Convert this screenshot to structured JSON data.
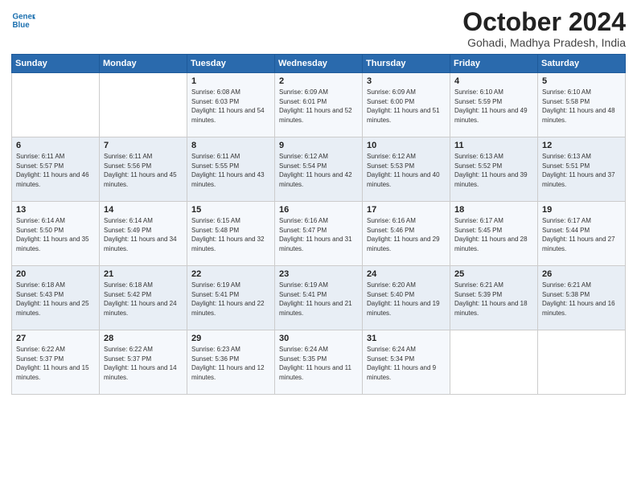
{
  "header": {
    "logo_line1": "General",
    "logo_line2": "Blue",
    "title": "October 2024",
    "subtitle": "Gohadi, Madhya Pradesh, India"
  },
  "weekdays": [
    "Sunday",
    "Monday",
    "Tuesday",
    "Wednesday",
    "Thursday",
    "Friday",
    "Saturday"
  ],
  "weeks": [
    [
      {
        "day": "",
        "info": ""
      },
      {
        "day": "",
        "info": ""
      },
      {
        "day": "1",
        "info": "Sunrise: 6:08 AM\nSunset: 6:03 PM\nDaylight: 11 hours and 54 minutes."
      },
      {
        "day": "2",
        "info": "Sunrise: 6:09 AM\nSunset: 6:01 PM\nDaylight: 11 hours and 52 minutes."
      },
      {
        "day": "3",
        "info": "Sunrise: 6:09 AM\nSunset: 6:00 PM\nDaylight: 11 hours and 51 minutes."
      },
      {
        "day": "4",
        "info": "Sunrise: 6:10 AM\nSunset: 5:59 PM\nDaylight: 11 hours and 49 minutes."
      },
      {
        "day": "5",
        "info": "Sunrise: 6:10 AM\nSunset: 5:58 PM\nDaylight: 11 hours and 48 minutes."
      }
    ],
    [
      {
        "day": "6",
        "info": "Sunrise: 6:11 AM\nSunset: 5:57 PM\nDaylight: 11 hours and 46 minutes."
      },
      {
        "day": "7",
        "info": "Sunrise: 6:11 AM\nSunset: 5:56 PM\nDaylight: 11 hours and 45 minutes."
      },
      {
        "day": "8",
        "info": "Sunrise: 6:11 AM\nSunset: 5:55 PM\nDaylight: 11 hours and 43 minutes."
      },
      {
        "day": "9",
        "info": "Sunrise: 6:12 AM\nSunset: 5:54 PM\nDaylight: 11 hours and 42 minutes."
      },
      {
        "day": "10",
        "info": "Sunrise: 6:12 AM\nSunset: 5:53 PM\nDaylight: 11 hours and 40 minutes."
      },
      {
        "day": "11",
        "info": "Sunrise: 6:13 AM\nSunset: 5:52 PM\nDaylight: 11 hours and 39 minutes."
      },
      {
        "day": "12",
        "info": "Sunrise: 6:13 AM\nSunset: 5:51 PM\nDaylight: 11 hours and 37 minutes."
      }
    ],
    [
      {
        "day": "13",
        "info": "Sunrise: 6:14 AM\nSunset: 5:50 PM\nDaylight: 11 hours and 35 minutes."
      },
      {
        "day": "14",
        "info": "Sunrise: 6:14 AM\nSunset: 5:49 PM\nDaylight: 11 hours and 34 minutes."
      },
      {
        "day": "15",
        "info": "Sunrise: 6:15 AM\nSunset: 5:48 PM\nDaylight: 11 hours and 32 minutes."
      },
      {
        "day": "16",
        "info": "Sunrise: 6:16 AM\nSunset: 5:47 PM\nDaylight: 11 hours and 31 minutes."
      },
      {
        "day": "17",
        "info": "Sunrise: 6:16 AM\nSunset: 5:46 PM\nDaylight: 11 hours and 29 minutes."
      },
      {
        "day": "18",
        "info": "Sunrise: 6:17 AM\nSunset: 5:45 PM\nDaylight: 11 hours and 28 minutes."
      },
      {
        "day": "19",
        "info": "Sunrise: 6:17 AM\nSunset: 5:44 PM\nDaylight: 11 hours and 27 minutes."
      }
    ],
    [
      {
        "day": "20",
        "info": "Sunrise: 6:18 AM\nSunset: 5:43 PM\nDaylight: 11 hours and 25 minutes."
      },
      {
        "day": "21",
        "info": "Sunrise: 6:18 AM\nSunset: 5:42 PM\nDaylight: 11 hours and 24 minutes."
      },
      {
        "day": "22",
        "info": "Sunrise: 6:19 AM\nSunset: 5:41 PM\nDaylight: 11 hours and 22 minutes."
      },
      {
        "day": "23",
        "info": "Sunrise: 6:19 AM\nSunset: 5:41 PM\nDaylight: 11 hours and 21 minutes."
      },
      {
        "day": "24",
        "info": "Sunrise: 6:20 AM\nSunset: 5:40 PM\nDaylight: 11 hours and 19 minutes."
      },
      {
        "day": "25",
        "info": "Sunrise: 6:21 AM\nSunset: 5:39 PM\nDaylight: 11 hours and 18 minutes."
      },
      {
        "day": "26",
        "info": "Sunrise: 6:21 AM\nSunset: 5:38 PM\nDaylight: 11 hours and 16 minutes."
      }
    ],
    [
      {
        "day": "27",
        "info": "Sunrise: 6:22 AM\nSunset: 5:37 PM\nDaylight: 11 hours and 15 minutes."
      },
      {
        "day": "28",
        "info": "Sunrise: 6:22 AM\nSunset: 5:37 PM\nDaylight: 11 hours and 14 minutes."
      },
      {
        "day": "29",
        "info": "Sunrise: 6:23 AM\nSunset: 5:36 PM\nDaylight: 11 hours and 12 minutes."
      },
      {
        "day": "30",
        "info": "Sunrise: 6:24 AM\nSunset: 5:35 PM\nDaylight: 11 hours and 11 minutes."
      },
      {
        "day": "31",
        "info": "Sunrise: 6:24 AM\nSunset: 5:34 PM\nDaylight: 11 hours and 9 minutes."
      },
      {
        "day": "",
        "info": ""
      },
      {
        "day": "",
        "info": ""
      }
    ]
  ]
}
